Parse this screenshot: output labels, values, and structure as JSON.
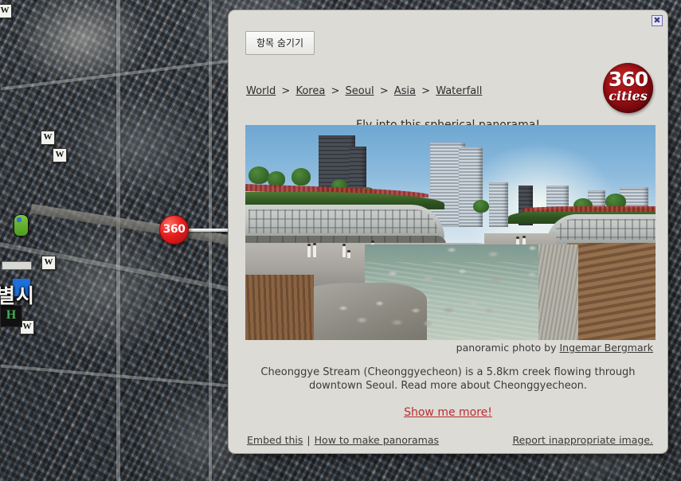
{
  "map": {
    "markers": {
      "panorama_marker_label": "360",
      "wikipedia_marker_label": "W",
      "hospital_marker_label": "H"
    },
    "labels": {
      "city_label": "별시"
    }
  },
  "dialog": {
    "close_label": "✖",
    "hide_button_label": "항목 숨기기",
    "logo": {
      "line1": "360",
      "line2": "cities"
    },
    "breadcrumb": {
      "items": [
        "World",
        "Korea",
        "Seoul",
        "Asia",
        "Waterfall"
      ],
      "separator": ">"
    },
    "fly_link_label": "Fly into this spherical panorama!",
    "credit": {
      "prefix": "panoramic photo by ",
      "author": "Ingemar Bergmark"
    },
    "description": "Cheonggye Stream (Cheonggyecheon) is a 5.8km creek flowing through downtown Seoul. Read more about Cheonggyecheon.",
    "show_more_label": "Show me more!",
    "footer": {
      "embed_label": "Embed this",
      "pipe": "|",
      "how_to_label": "How to make panoramas",
      "report_label": "Report inappropriate image."
    }
  },
  "colors": {
    "dialog_bg": "#dcdbd6",
    "link": "#2e2e2e",
    "accent_red": "#bb2d2d",
    "logo_red": "#9a0f13",
    "marker_red": "#e61e1e"
  }
}
